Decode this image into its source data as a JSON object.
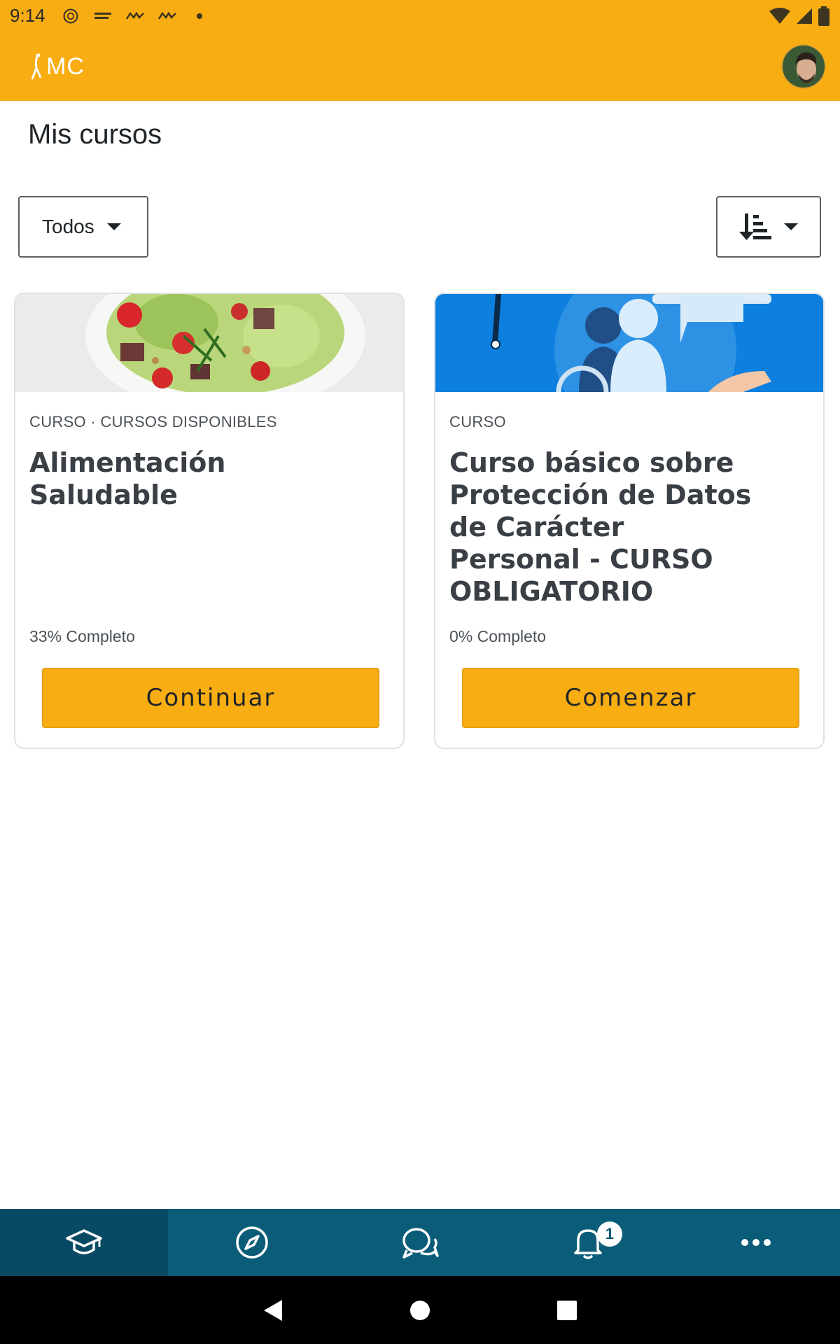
{
  "status_bar": {
    "time": "9:14",
    "icons_left": [
      "settings-wheel-icon",
      "university-logo-icon",
      "app-notification-icon",
      "app-notification-icon",
      "dot-icon"
    ],
    "icons_right": [
      "wifi-icon",
      "signal-icon",
      "battery-icon"
    ]
  },
  "app_bar": {
    "logo_text": "MC",
    "brand_color": "#f8ad12"
  },
  "page": {
    "title": "Mis cursos"
  },
  "filters": {
    "status_selected": "Todos",
    "sort_icon": "sort-descending-icon"
  },
  "courses": [
    {
      "category": "CURSO · CURSOS DISPONIBLES",
      "title": "Alimentación Saludable",
      "progress_text": "33% Completo",
      "progress": 0.33,
      "button_label": "Continuar",
      "image": "salad-image"
    },
    {
      "category": "CURSO",
      "title": "Curso básico sobre Protección de Datos de Carácter Personal - CURSO OBLIGATORIO",
      "progress_text": "0% Completo",
      "progress": 0,
      "button_label": "Comenzar",
      "image": "data-protection-illustration"
    }
  ],
  "bottom_nav": {
    "items": [
      "courses-icon",
      "discover-icon",
      "messages-icon",
      "notifications-icon",
      "more-icon"
    ],
    "notification_count": "1",
    "background_color": "#0b5c78"
  }
}
